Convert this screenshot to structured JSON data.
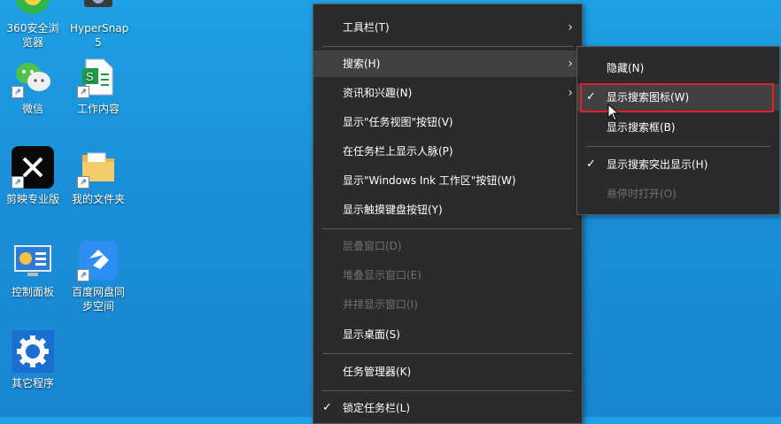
{
  "desktop": {
    "icons": [
      {
        "label": "360安全浏览器"
      },
      {
        "label": "HyperSnap 5"
      },
      {
        "label": "微信"
      },
      {
        "label": "工作内容"
      },
      {
        "label": "剪映专业版"
      },
      {
        "label": "我的文件夹"
      },
      {
        "label": "控制面板"
      },
      {
        "label": "百度网盘同步空间"
      },
      {
        "label": "其它程序"
      }
    ]
  },
  "context_menu": {
    "items": [
      {
        "label": "工具栏(T)"
      },
      {
        "label": "搜索(H)"
      },
      {
        "label": "资讯和兴趣(N)"
      },
      {
        "label": "显示\"任务视图\"按钮(V)"
      },
      {
        "label": "在任务栏上显示人脉(P)"
      },
      {
        "label": "显示\"Windows Ink 工作区\"按钮(W)"
      },
      {
        "label": "显示触摸键盘按钮(Y)"
      },
      {
        "label": "层叠窗口(D)"
      },
      {
        "label": "堆叠显示窗口(E)"
      },
      {
        "label": "并排显示窗口(I)"
      },
      {
        "label": "显示桌面(S)"
      },
      {
        "label": "任务管理器(K)"
      },
      {
        "label": "锁定任务栏(L)"
      }
    ]
  },
  "submenu": {
    "items": [
      {
        "label": "隐藏(N)"
      },
      {
        "label": "显示搜索图标(W)"
      },
      {
        "label": "显示搜索框(B)"
      },
      {
        "label": "显示搜索突出显示(H)"
      },
      {
        "label": "悬停时打开(O)"
      }
    ]
  },
  "colors": {
    "desktop": "#1a8cd8",
    "menu_bg": "#2b2b2b",
    "highlight": "#414141",
    "annotation": "#e0212a"
  },
  "glyphs": {
    "check": "✓",
    "arrow": "›"
  }
}
